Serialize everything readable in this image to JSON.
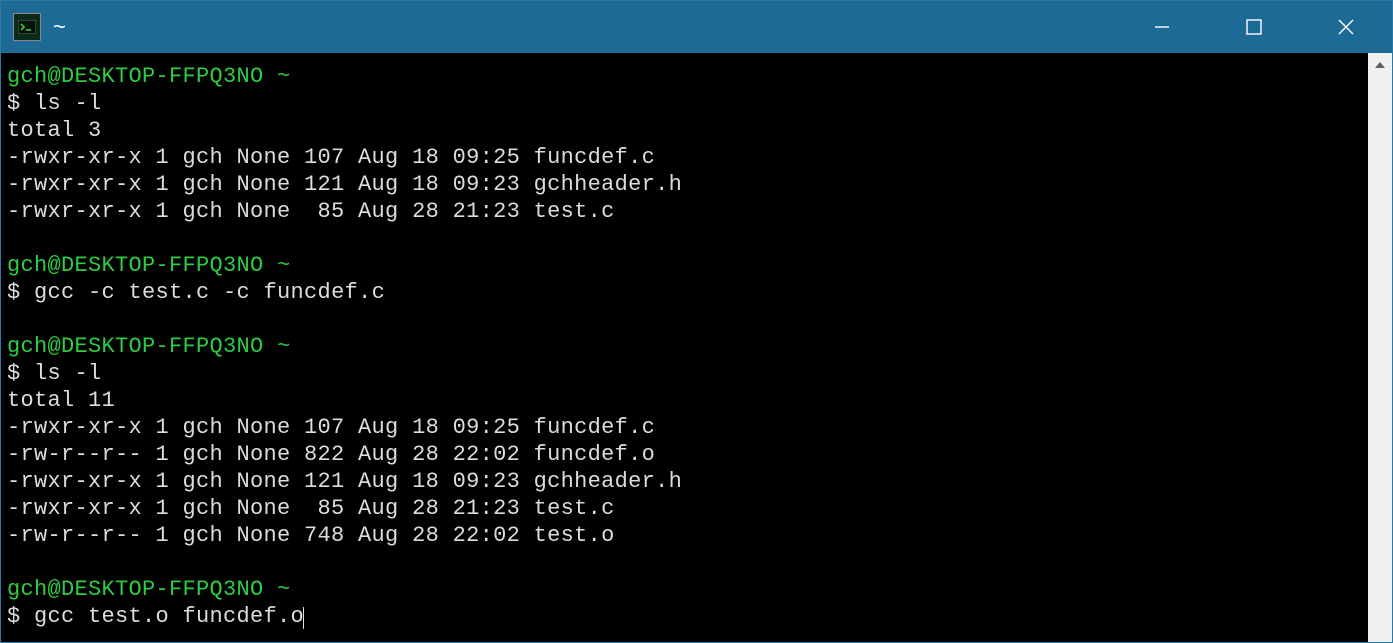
{
  "window": {
    "title": "~"
  },
  "terminal": {
    "blocks": [
      {
        "prompt_lead": "gch@DESKTOP-FFPQ3NO ~",
        "prompt_sym": "$ ",
        "command": "ls -l",
        "output": [
          "total 3",
          "-rwxr-xr-x 1 gch None 107 Aug 18 09:25 funcdef.c",
          "-rwxr-xr-x 1 gch None 121 Aug 18 09:23 gchheader.h",
          "-rwxr-xr-x 1 gch None  85 Aug 28 21:23 test.c"
        ]
      },
      {
        "prompt_lead": "gch@DESKTOP-FFPQ3NO ~",
        "prompt_sym": "$ ",
        "command": "gcc -c test.c -c funcdef.c",
        "output": []
      },
      {
        "prompt_lead": "gch@DESKTOP-FFPQ3NO ~",
        "prompt_sym": "$ ",
        "command": "ls -l",
        "output": [
          "total 11",
          "-rwxr-xr-x 1 gch None 107 Aug 18 09:25 funcdef.c",
          "-rw-r--r-- 1 gch None 822 Aug 28 22:02 funcdef.o",
          "-rwxr-xr-x 1 gch None 121 Aug 18 09:23 gchheader.h",
          "-rwxr-xr-x 1 gch None  85 Aug 28 21:23 test.c",
          "-rw-r--r-- 1 gch None 748 Aug 28 22:02 test.o"
        ]
      },
      {
        "prompt_lead": "gch@DESKTOP-FFPQ3NO ~",
        "prompt_sym": "$ ",
        "command": "gcc test.o funcdef.o",
        "output": [],
        "current": true
      }
    ]
  }
}
